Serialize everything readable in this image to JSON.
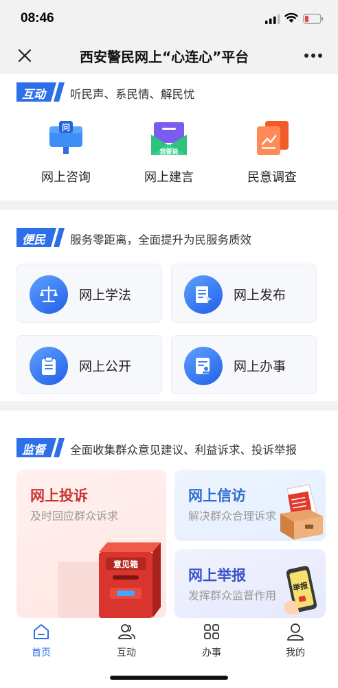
{
  "status": {
    "time": "08:46"
  },
  "nav": {
    "title": "西安警民网上“心连心”平台"
  },
  "interact": {
    "tag": "互动",
    "subtitle": "听民声、系民情、解民忧",
    "items": [
      {
        "label": "网上咨询",
        "icon": "consult-icon"
      },
      {
        "label": "网上建言",
        "icon": "suggestion-icon",
        "badge": "我要说"
      },
      {
        "label": "民意调查",
        "icon": "survey-icon"
      }
    ]
  },
  "convenience": {
    "tag": "便民",
    "subtitle": "服务零距离，全面提升为民服务质效",
    "items": [
      {
        "label": "网上学法",
        "icon": "scale-icon"
      },
      {
        "label": "网上发布",
        "icon": "publish-icon"
      },
      {
        "label": "网上公开",
        "icon": "clipboard-icon"
      },
      {
        "label": "网上办事",
        "icon": "document-stamp-icon"
      }
    ]
  },
  "supervise": {
    "tag": "监督",
    "subtitle": "全面收集群众意见建议、利益诉求、投诉举报",
    "complaint": {
      "title": "网上投诉",
      "desc": "及时回应群众诉求",
      "box_label": "意见箱"
    },
    "petition": {
      "title": "网上信访",
      "desc": "解决群众合理诉求"
    },
    "report": {
      "title": "网上举报",
      "desc": "发挥群众监督作用",
      "phone_text": "举报"
    }
  },
  "tabs": [
    {
      "label": "首页",
      "icon": "home-icon",
      "active": true
    },
    {
      "label": "互动",
      "icon": "users-icon"
    },
    {
      "label": "办事",
      "icon": "grid-icon"
    },
    {
      "label": "我的",
      "icon": "person-icon"
    }
  ],
  "colors": {
    "accent": "#2c6fe8",
    "complaint_red": "#c8342e",
    "petition_blue": "#2f6bd0",
    "report_blue": "#3a52c8"
  }
}
